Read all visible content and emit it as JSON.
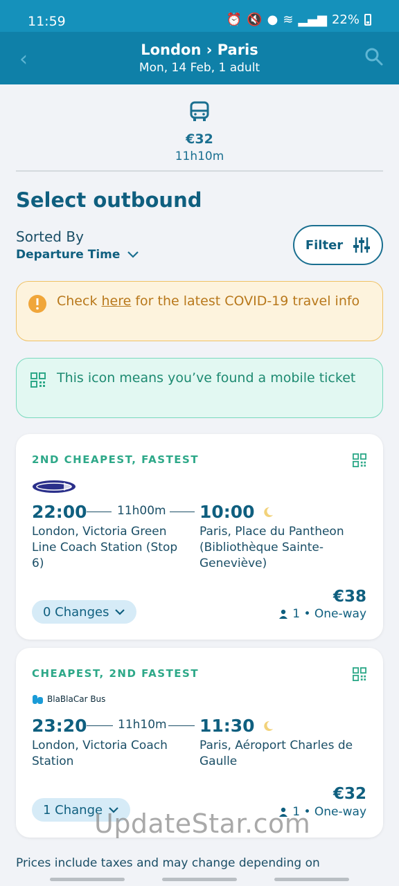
{
  "status": {
    "time": "11:59",
    "battery": "22%"
  },
  "header": {
    "title": "London › Paris",
    "subtitle": "Mon, 14 Feb, 1 adult"
  },
  "mode_tab": {
    "price": "€32",
    "duration": "11h10m"
  },
  "section_title": "Select outbound",
  "sort": {
    "label": "Sorted By",
    "value": "Departure Time"
  },
  "filter_label": "Filter",
  "covid_banner": {
    "pre": "Check ",
    "link": "here",
    "post": " for the latest COVID-19 travel info"
  },
  "mobile_banner": {
    "text": "This icon means you’ve found a mobile ticket"
  },
  "results": [
    {
      "badge": "2ND CHEAPEST, FASTEST",
      "operator": "",
      "departure_time": "22:00",
      "duration": "11h00m",
      "arrival_time": "10:00",
      "from": "London, Victoria Green Line Coach Station (Stop 6)",
      "to": "Paris, Place du Pantheon (Bibliothèque Sainte-Geneviève)",
      "changes": "0 Changes",
      "price": "€38",
      "passengers": "1 • One-way"
    },
    {
      "badge": "CHEAPEST, 2ND FASTEST",
      "operator": "BlaBlaCar Bus",
      "departure_time": "23:20",
      "duration": "11h10m",
      "arrival_time": "11:30",
      "from": "London, Victoria Coach Station",
      "to": "Paris, Aéroport Charles de Gaulle",
      "changes": "1 Change",
      "price": "€32",
      "passengers": "1 • One-way"
    }
  ],
  "footer_text": "Prices include taxes and may change depending on",
  "watermark": "UpdateStar.com",
  "colors": {
    "header": "#0f80a8",
    "statusbar": "#1591bb",
    "accent": "#0f5f7f",
    "badge_green": "#2da888"
  }
}
